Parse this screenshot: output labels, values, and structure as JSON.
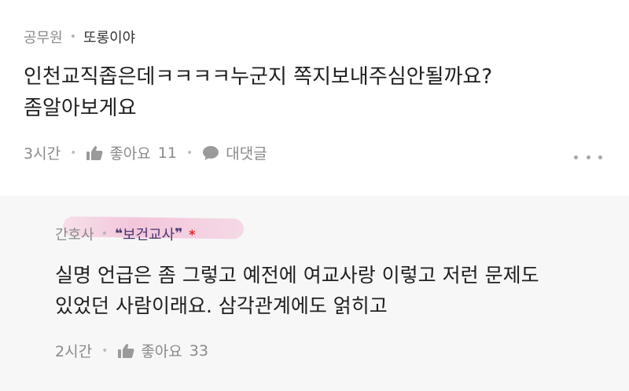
{
  "comment": {
    "job": "공무원",
    "nickname": "또롱이야",
    "lines": [
      "인천교직좁은데ㅋㅋㅋㅋ누군지 쪽지보내주심안될까요?",
      "좀알아보게요"
    ],
    "time": "3시간",
    "like_label": "좋아요",
    "like_count": "11",
    "reply_label": "대댓글"
  },
  "reply": {
    "job": "간호사",
    "badge_open": "❝",
    "nickname": "보건교사",
    "badge_close": "❞",
    "author_mark": "*",
    "lines": [
      "실명 언급은 좀 그렇고 예전에 여교사랑 이렇고 저런 문제도",
      "있었던 사람이래요. 삼각관계에도 얽히고"
    ],
    "time": "2시간",
    "like_label": "좋아요",
    "like_count": "33"
  },
  "icons": {
    "like": "thumbs-up-icon",
    "reply": "speech-bubble-icon",
    "more": "more-dots-icon"
  },
  "colors": {
    "background": "#ffffff",
    "reply_background": "#f7f7f8",
    "meta_gray": "#8a8a8a",
    "badge_purple": "#4a3570",
    "author_mark_red": "#e8262a",
    "highlighter_pink": "#f0a0c3"
  }
}
